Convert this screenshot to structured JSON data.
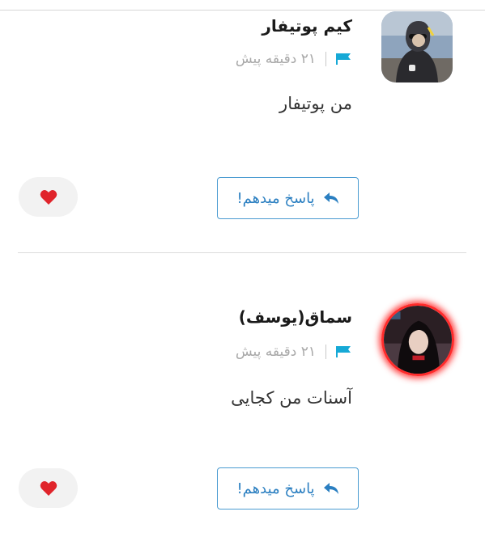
{
  "comments": [
    {
      "author": "کیم پوتیفار",
      "time": "۲۱ دقیقه پیش",
      "text": "من پوتیفار",
      "reply_label": "پاسخ میدهم!",
      "avatar_icon": "avatar-photo-icon",
      "flag_icon": "flag-icon",
      "like_icon": "heart-icon"
    },
    {
      "author": "سماق(یوسف)",
      "time": "۲۱ دقیقه پیش",
      "text": "آسنات من کجایی",
      "reply_label": "پاسخ میدهم!",
      "avatar_icon": "avatar-photo-icon",
      "flag_icon": "flag-icon",
      "like_icon": "heart-icon"
    }
  ],
  "colors": {
    "accent": "#2b7fc1",
    "flag": "#16a9d6",
    "heart": "#e0242b",
    "avatar_glow": "#ff2b2b"
  }
}
